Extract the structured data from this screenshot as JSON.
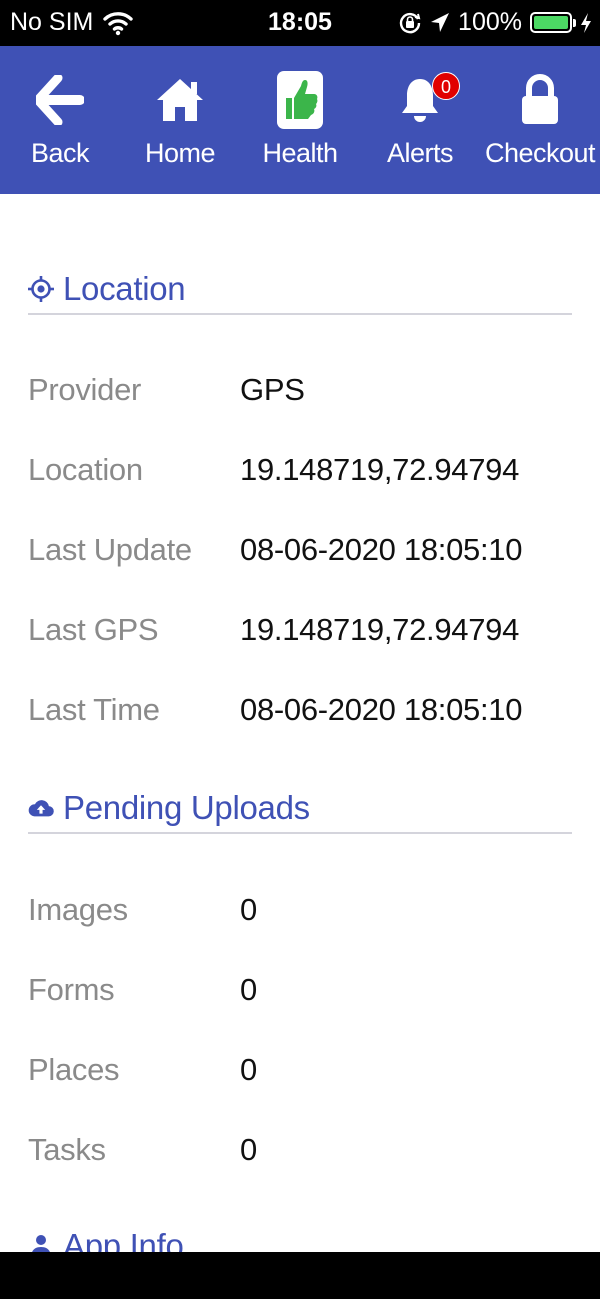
{
  "status_bar": {
    "carrier": "No SIM",
    "time": "18:05",
    "battery": "100%",
    "battery_level": 1.0
  },
  "nav": {
    "back": "Back",
    "home": "Home",
    "health": "Health",
    "alerts": "Alerts",
    "alerts_count": "0",
    "checkout": "Checkout"
  },
  "location": {
    "title": "Location",
    "rows": [
      {
        "key": "Provider",
        "value": "GPS"
      },
      {
        "key": "Location",
        "value": "19.148719,72.94794"
      },
      {
        "key": "Last Update",
        "value": "08-06-2020 18:05:10"
      },
      {
        "key": "Last GPS",
        "value": "19.148719,72.94794"
      },
      {
        "key": "Last Time",
        "value": "08-06-2020 18:05:10"
      }
    ]
  },
  "pending_uploads": {
    "title": "Pending Uploads",
    "rows": [
      {
        "key": "Images",
        "value": "0"
      },
      {
        "key": "Forms",
        "value": "0"
      },
      {
        "key": "Places",
        "value": "0"
      },
      {
        "key": "Tasks",
        "value": "0"
      }
    ]
  },
  "app_info": {
    "title": "App Info"
  },
  "colors": {
    "primary": "#3f51b5",
    "badge": "#e10000",
    "health_icon": "#3bb54a",
    "battery": "#4cd964"
  }
}
